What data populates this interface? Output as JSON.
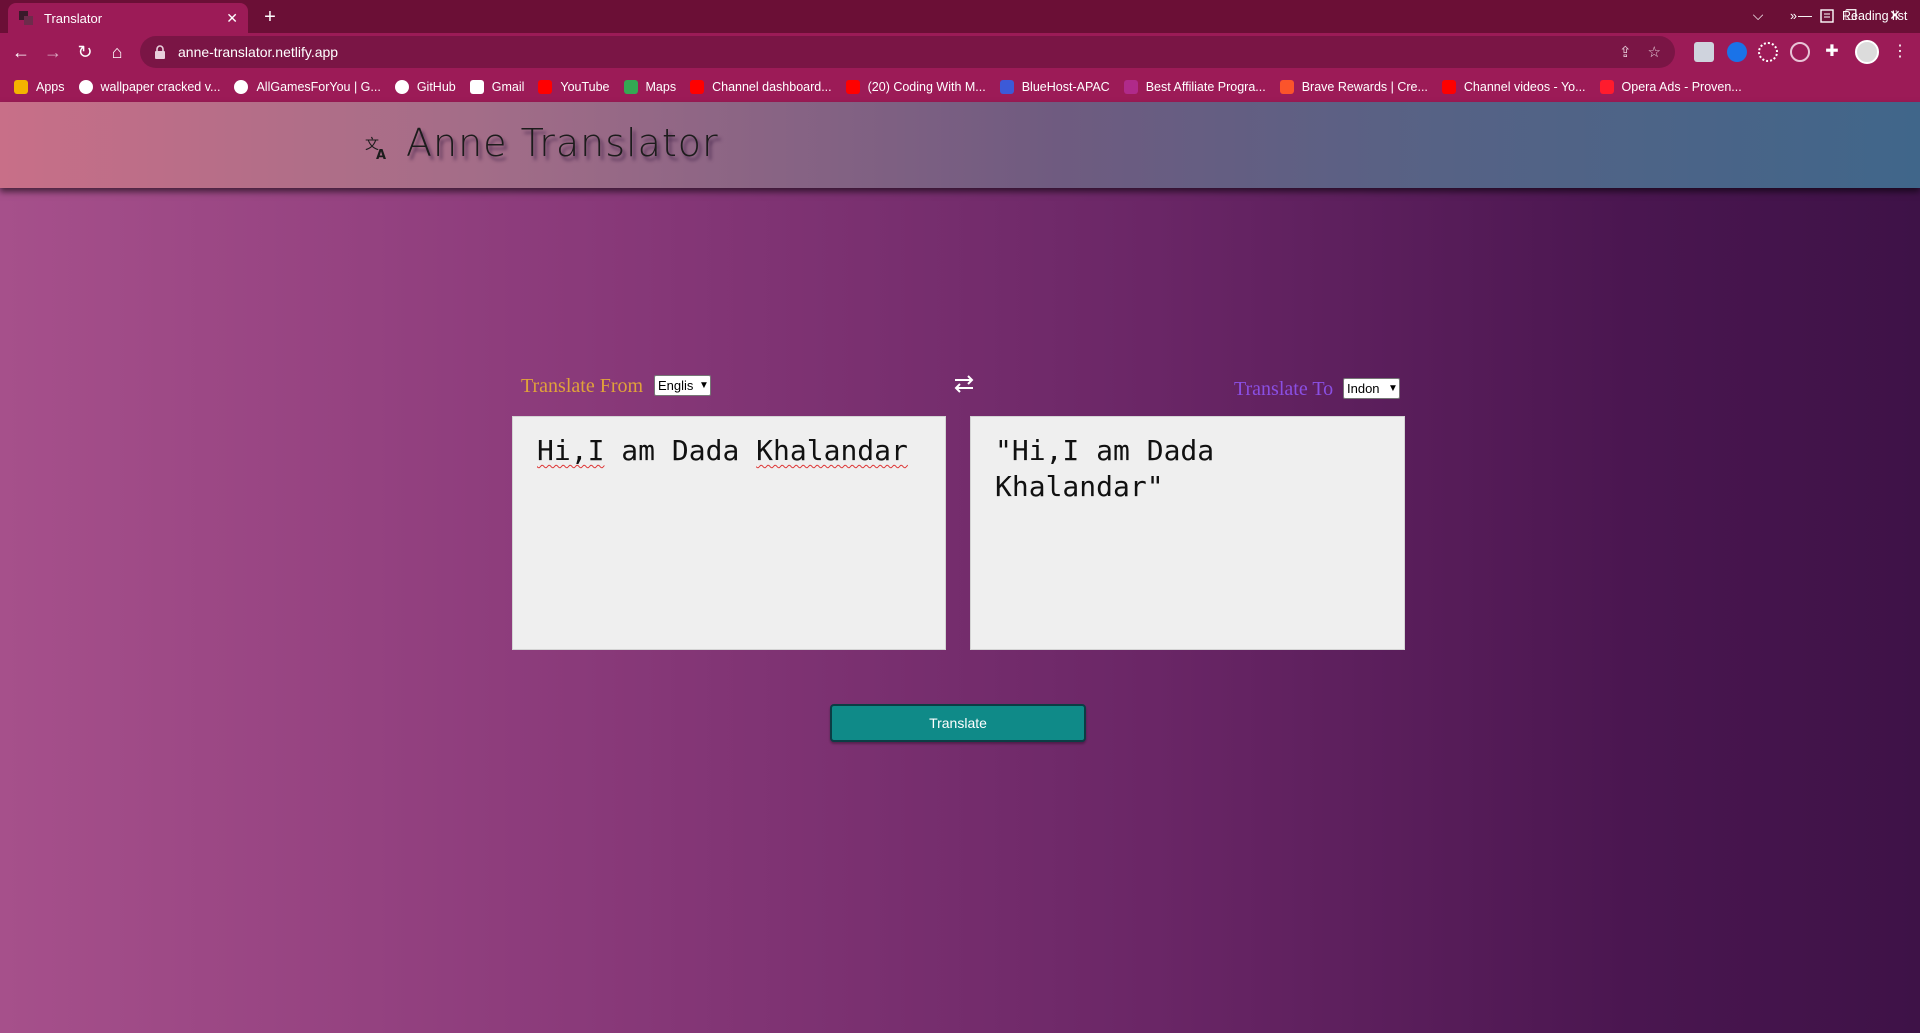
{
  "browser": {
    "tab": {
      "title": "Translator",
      "close": "✕"
    },
    "new_tab": "+",
    "window_controls": {
      "dropdown": "⌵",
      "minimize": "—",
      "restore": "❐",
      "close": "✕"
    },
    "nav": {
      "back": "←",
      "forward": "→",
      "reload": "↻",
      "home": "⌂"
    },
    "address": {
      "url": "anne-translator.netlify.app"
    },
    "omnibox_icons": [
      "share-icon",
      "star-icon"
    ],
    "extensions": [
      "cube-extension-icon",
      "blue-extension-icon",
      "gear-extension-icon",
      "circle-extension-icon",
      "puzzle-icon",
      "profile-avatar",
      "menu-icon"
    ],
    "bookmarks": [
      {
        "label": "Apps",
        "icon": "apps-grid-icon",
        "color": "#f4b400"
      },
      {
        "label": "wallpaper cracked v...",
        "icon": "globe-icon",
        "color": "#ffffff"
      },
      {
        "label": "AllGamesForYou | G...",
        "icon": "globe-icon",
        "color": "#ffffff"
      },
      {
        "label": "GitHub",
        "icon": "github-icon",
        "color": "#ffffff"
      },
      {
        "label": "Gmail",
        "icon": "gmail-icon",
        "color": "#ffffff"
      },
      {
        "label": "YouTube",
        "icon": "youtube-icon",
        "color": "#ff0000"
      },
      {
        "label": "Maps",
        "icon": "maps-icon",
        "color": "#34a853"
      },
      {
        "label": "Channel dashboard...",
        "icon": "youtube-icon",
        "color": "#ff0000"
      },
      {
        "label": "(20) Coding With M...",
        "icon": "youtube-icon",
        "color": "#ff0000"
      },
      {
        "label": "BlueHost-APAC",
        "icon": "grid-icon",
        "color": "#3c5ad8"
      },
      {
        "label": "Best Affiliate Progra...",
        "icon": "affiliate-icon",
        "color": "#b02a8a"
      },
      {
        "label": "Brave Rewards | Cre...",
        "icon": "brave-icon",
        "color": "#fb542b"
      },
      {
        "label": "Channel videos - Yo...",
        "icon": "youtube-icon",
        "color": "#ff0000"
      },
      {
        "label": "Opera Ads - Proven...",
        "icon": "opera-icon",
        "color": "#ff1b2d"
      }
    ],
    "bookmarks_overflow": "»",
    "reading_list": "Reading list"
  },
  "app": {
    "brand_title": "Anne Translator",
    "from_label": "Translate From",
    "from_language": "Englis",
    "to_label": "Translate To",
    "to_language": "Indon",
    "source_text": [
      "Hi,I",
      " am Dada ",
      "Khalandar"
    ],
    "target_text": "\"Hi,I am Dada Khalandar\"",
    "translate_button": "Translate"
  }
}
